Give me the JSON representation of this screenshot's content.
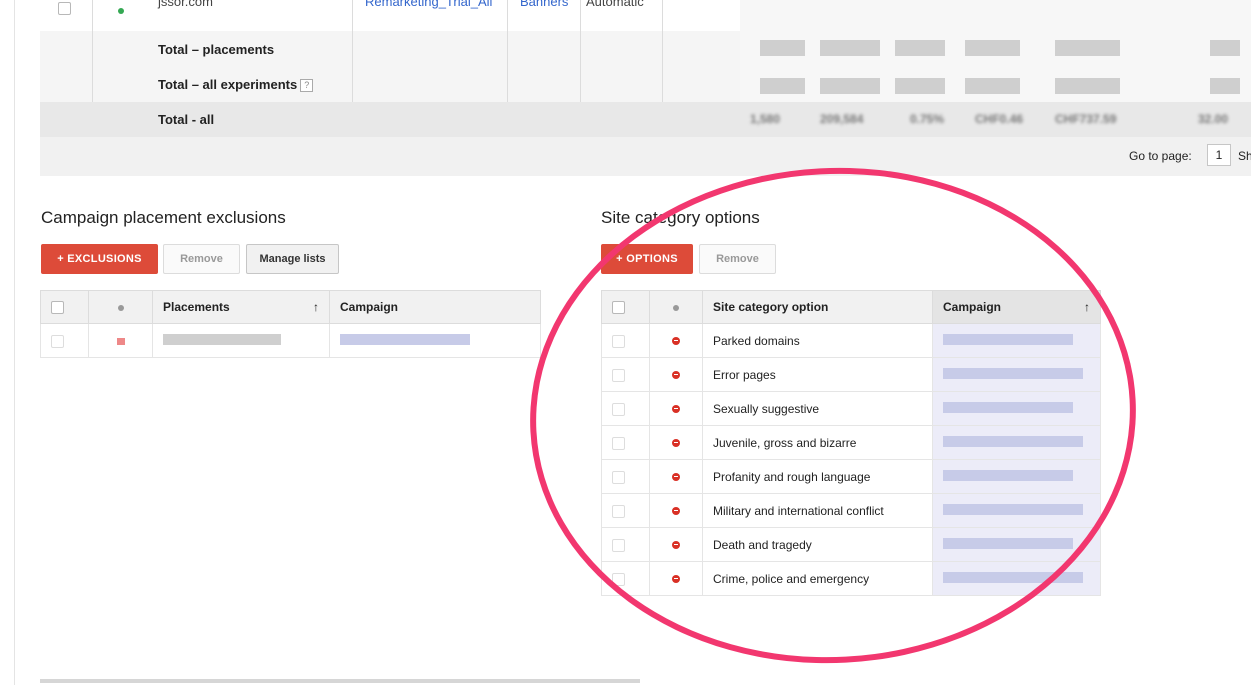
{
  "top_table": {
    "partial_row": {
      "domain": "jssor.com",
      "campaign": "Remarketing_Trial_All",
      "ad_type": "Banners",
      "bidding": "Automatic"
    },
    "totals": {
      "placements": "Total – placements",
      "experiments": "Total – all experiments",
      "experiments_help": "?",
      "all": "Total - all"
    },
    "total_all_values": [
      "1,580",
      "209,584",
      "0.75%",
      "CHF0.46",
      "CHF737.59",
      "32.00"
    ],
    "pager": {
      "label": "Go to page:",
      "page": "1",
      "show_label": "Sh"
    }
  },
  "placement_exclusions": {
    "title": "Campaign placement exclusions",
    "add_button": "EXCLUSIONS",
    "remove_button": "Remove",
    "manage_button": "Manage lists",
    "columns": [
      "Placements",
      "Campaign"
    ],
    "sort_icon": "↑"
  },
  "site_category": {
    "title": "Site category options",
    "add_button": "OPTIONS",
    "remove_button": "Remove",
    "columns": [
      "Site category option",
      "Campaign"
    ],
    "sort_icon": "↑",
    "rows": [
      "Parked domains",
      "Error pages",
      "Sexually suggestive",
      "Juvenile, gross and bizarre",
      "Profanity and rough language",
      "Military and international conflict",
      "Death and tragedy",
      "Crime, police and emergency"
    ]
  },
  "colors": {
    "accent_red": "#dd4b39",
    "highlight_ellipse": "#f2376f",
    "status_green": "#34a853"
  }
}
